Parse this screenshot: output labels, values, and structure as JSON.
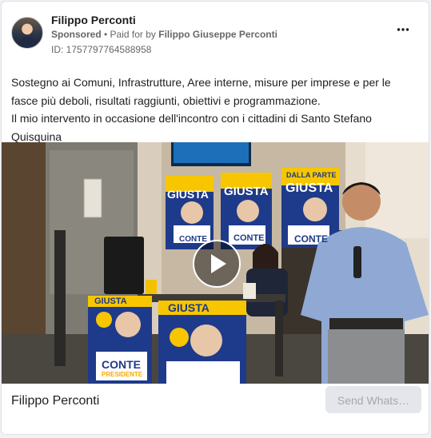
{
  "post": {
    "author": "Filippo Perconti",
    "sponsored": "Sponsored",
    "separator": " • ",
    "paid_for_prefix": "Paid for by ",
    "paid_for_by": "Filippo Giuseppe Perconti",
    "ad_id": "ID: 1757797764588958",
    "more_icon": "more-horizontal-icon",
    "text_line1": "Sostegno ai Comuni, Infrastrutture, Aree interne, misure per imprese e per le fasce più deboli, risultati raggiunti, obiettivi e programmazione.",
    "text_line2": "Il mio intervento in occasione dell'incontro con i cittadini di Santo Stefano Quisquina"
  },
  "media": {
    "play_icon": "play-icon",
    "poster_headline": "DALLA PARTE",
    "poster_word": "GIUSTA",
    "poster_name": "CONTE",
    "poster_sub": "PRESIDENTE",
    "poster_badge": "MOVIMENTO 5 STELLE 2050"
  },
  "footer": {
    "page_name": "Filippo Perconti",
    "cta_label": "Send Whats…"
  },
  "colors": {
    "poster_blue": "#1e3a8a",
    "poster_yellow": "#f7c600",
    "cta_bg": "#e4e6eb",
    "cta_text": "#a5a8ad"
  }
}
